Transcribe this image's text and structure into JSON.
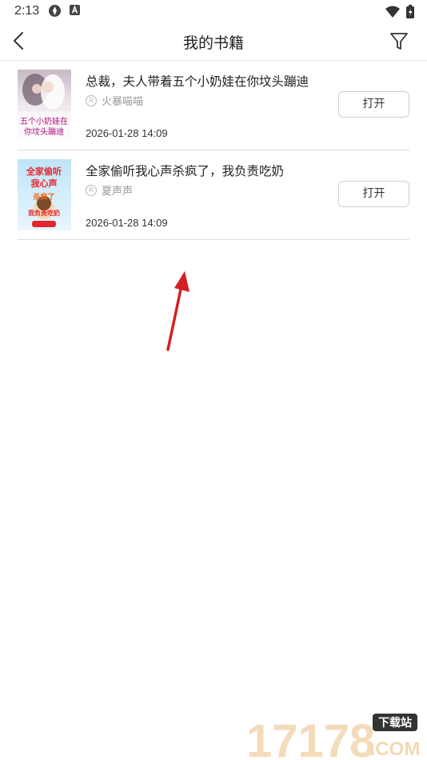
{
  "status_bar": {
    "time": "2:13"
  },
  "header": {
    "title": "我的书籍"
  },
  "books": [
    {
      "title": "总裁，夫人带着五个小奶娃在你坟头蹦迪",
      "author": "火暴喵喵",
      "date": "2026-01-28 14:09",
      "open_label": "打开",
      "cover_text": [
        "五个小奶娃在",
        "你坟头蹦迪"
      ]
    },
    {
      "title": "全家偷听我心声杀疯了，我负责吃奶",
      "author": "夏声声",
      "date": "2026-01-28 14:09",
      "open_label": "打开",
      "cover_text": [
        "全家偷听",
        "我心声",
        "杀疯了",
        "我负责吃奶"
      ]
    }
  ],
  "watermark": {
    "number": "17178",
    "badge": "下载站",
    "domain": ".COM"
  }
}
